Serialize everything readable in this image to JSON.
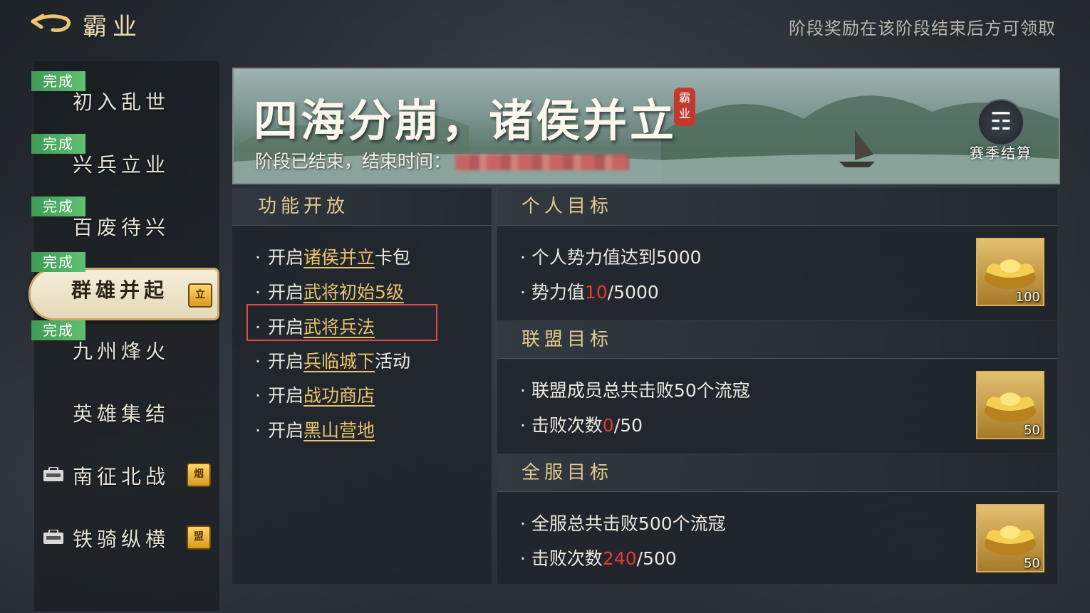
{
  "header": {
    "title": "霸业",
    "notice": "阶段奖励在该阶段结束后方可领取"
  },
  "sidebar": {
    "stages": [
      {
        "label": "初入乱世",
        "status": "完成"
      },
      {
        "label": "兴兵立业",
        "status": "完成"
      },
      {
        "label": "百废待兴",
        "status": "完成"
      },
      {
        "label": "群雄并起",
        "status": "完成",
        "tag": "立"
      },
      {
        "label": "九州烽火",
        "status": "完成"
      },
      {
        "label": "英雄集结"
      },
      {
        "label": "南征北战",
        "tag": "烟",
        "locked": true
      },
      {
        "label": "铁骑纵横",
        "tag": "盟",
        "locked": true
      }
    ]
  },
  "banner": {
    "title": "四海分崩，诸侯并立",
    "seal": "霸业",
    "ended_label": "阶段已结束，结束时间：",
    "settle_label": "赛季结算",
    "settle_icon": "season-settle-icon"
  },
  "features": {
    "heading": "功能开放",
    "items": [
      {
        "prefix": "开启",
        "link": "诸侯并立",
        "suffix": "卡包"
      },
      {
        "prefix": "开启",
        "link": "武将初始5级",
        "suffix": ""
      },
      {
        "prefix": "开启",
        "link": "武将兵法",
        "suffix": ""
      },
      {
        "prefix": "开启",
        "link": "兵临城下",
        "suffix": "活动"
      },
      {
        "prefix": "开启",
        "link": "战功商店",
        "suffix": ""
      },
      {
        "prefix": "开启",
        "link": "黑山营地",
        "suffix": ""
      }
    ]
  },
  "goals": {
    "personal": {
      "heading": "个人目标",
      "line1": "个人势力值达到5000",
      "line2_label": "势力值",
      "progress": "10",
      "target": "/5000",
      "reward_count": "100"
    },
    "alliance": {
      "heading": "联盟目标",
      "line1": "联盟成员总共击败50个流寇",
      "line2_label": "击败次数",
      "progress": "0",
      "target": "/50",
      "reward_count": "50"
    },
    "server": {
      "heading": "全服目标",
      "line1": "全服总共击败500个流寇",
      "line2_label": "击败次数",
      "progress": "240",
      "target": "/500",
      "reward_count": "50"
    }
  },
  "colors": {
    "done_badge": "#4fae63",
    "link_gold": "#e8c36b",
    "progress_red": "#e23a32",
    "highlight": "#e04a4a"
  }
}
